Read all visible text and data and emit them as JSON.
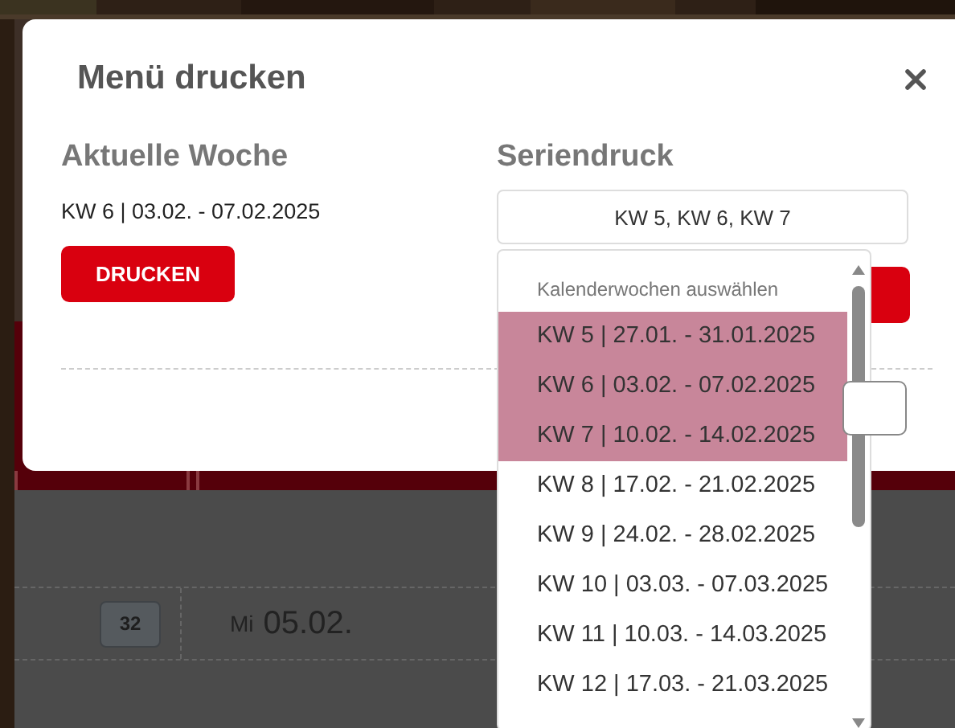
{
  "background": {
    "badge": "32",
    "weekday": "Mi",
    "date": "05.02."
  },
  "dialog": {
    "title": "Menü drucken",
    "current_week": {
      "heading": "Aktuelle Woche",
      "week": "KW 6 | 03.02. - 07.02.2025",
      "button": "DRUCKEN"
    },
    "series": {
      "heading": "Seriendruck",
      "value": "KW 5, KW 6, KW 7"
    },
    "dropdown": {
      "header": "Kalenderwochen auswählen",
      "options": [
        {
          "label": "KW 5 | 27.01. - 31.01.2025",
          "selected": true
        },
        {
          "label": "KW 6 | 03.02. - 07.02.2025",
          "selected": true
        },
        {
          "label": "KW 7 | 10.02. - 14.02.2025",
          "selected": true
        },
        {
          "label": "KW 8 | 17.02. - 21.02.2025",
          "selected": false
        },
        {
          "label": "KW 9 | 24.02. - 28.02.2025",
          "selected": false
        },
        {
          "label": "KW 10 | 03.03. - 07.03.2025",
          "selected": false
        },
        {
          "label": "KW 11 | 10.03. - 14.03.2025",
          "selected": false
        },
        {
          "label": "KW 12 | 17.03. - 21.03.2025",
          "selected": false
        }
      ]
    }
  }
}
